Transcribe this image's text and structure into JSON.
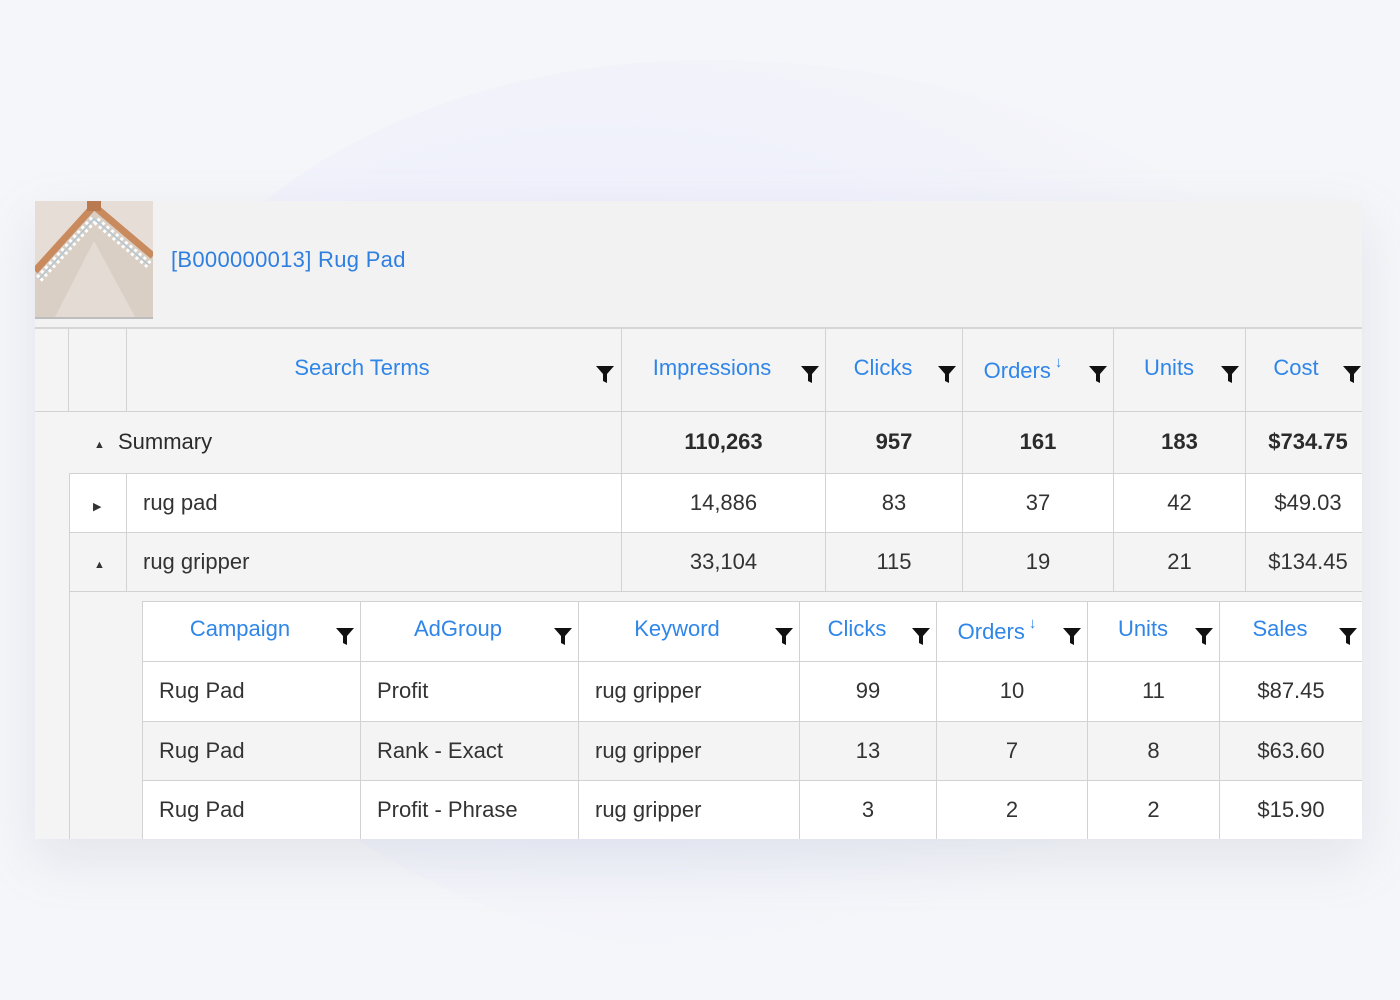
{
  "product": {
    "title": "[B000000013] Rug Pad",
    "image_icon": "rug-pad-product-image"
  },
  "main_table": {
    "headers": [
      "Search Terms",
      "Impressions",
      "Clicks",
      "Orders",
      "Units",
      "Cost"
    ],
    "sorted_column": "Orders",
    "sort_indicator": "↓",
    "summary": {
      "label": "Summary",
      "toggle": "▲",
      "impressions": "110,263",
      "clicks": "957",
      "orders": "161",
      "units": "183",
      "cost": "$734.75"
    },
    "rows": [
      {
        "toggle": "▶",
        "term": "rug pad",
        "impressions": "14,886",
        "clicks": "83",
        "orders": "37",
        "units": "42",
        "cost": "$49.03"
      },
      {
        "toggle": "▲",
        "term": "rug gripper",
        "impressions": "33,104",
        "clicks": "115",
        "orders": "19",
        "units": "21",
        "cost": "$134.45"
      }
    ]
  },
  "sub_table": {
    "headers": [
      "Campaign",
      "AdGroup",
      "Keyword",
      "Clicks",
      "Orders",
      "Units",
      "Sales"
    ],
    "sorted_column": "Orders",
    "sort_indicator": "↓",
    "rows": [
      {
        "campaign": "Rug Pad",
        "adgroup": "Profit",
        "keyword": "rug gripper",
        "clicks": "99",
        "orders": "10",
        "units": "11",
        "sales": "$87.45"
      },
      {
        "campaign": "Rug Pad",
        "adgroup": "Rank - Exact",
        "keyword": "rug gripper",
        "clicks": "13",
        "orders": "7",
        "units": "8",
        "sales": "$63.60"
      },
      {
        "campaign": "Rug Pad",
        "adgroup": "Profit - Phrase",
        "keyword": "rug gripper",
        "clicks": "3",
        "orders": "2",
        "units": "2",
        "sales": "$15.90"
      }
    ]
  },
  "icons": {
    "filter": "filter-icon",
    "expand": "expand-arrow-icon",
    "collapse": "collapse-arrow-icon"
  }
}
